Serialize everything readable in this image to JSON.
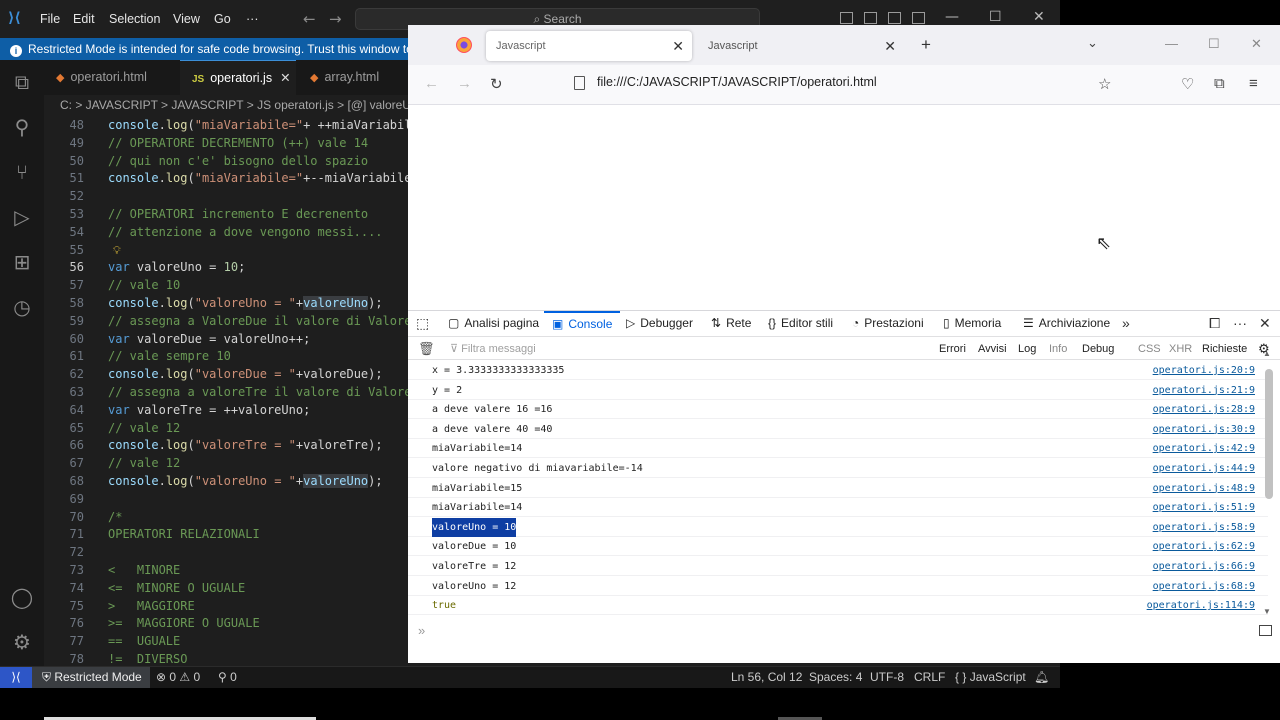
{
  "vscode": {
    "menu": [
      "File",
      "Edit",
      "Selection",
      "View",
      "Go",
      "···"
    ],
    "search_label": "Search",
    "banner": "Restricted Mode is intended for safe code browsing. Trust this window to enable all features.",
    "tabs": [
      {
        "label": "operatori.html",
        "active": false
      },
      {
        "label": "operatori.js",
        "active": true
      },
      {
        "label": "array.html",
        "active": false
      }
    ],
    "breadcrumb": "C: > JAVASCRIPT > JAVASCRIPT > JS operatori.js > [@] valoreUno",
    "lines": [
      {
        "n": "48",
        "t": "console.log(\"miaVariabile=\"+ ++miaVariabile);"
      },
      {
        "n": "49",
        "t": "// OPERATORE DECREMENTO (++) vale 14"
      },
      {
        "n": "50",
        "t": "// qui non c'e' bisogno dello spazio"
      },
      {
        "n": "51",
        "t": "console.log(\"miaVariabile=\"+--miaVariabile);"
      },
      {
        "n": "52",
        "t": ""
      },
      {
        "n": "53",
        "t": "// OPERATORI incremento E decrenento"
      },
      {
        "n": "54",
        "t": "// attenzione a dove vengono messi...."
      },
      {
        "n": "55",
        "t": ""
      },
      {
        "n": "56",
        "t": "var valoreUno = 10;"
      },
      {
        "n": "57",
        "t": "// vale 10"
      },
      {
        "n": "58",
        "t": "console.log(\"valoreUno = \"+valoreUno);"
      },
      {
        "n": "59",
        "t": "// assegna a ValoreDue il valore di ValoreUno"
      },
      {
        "n": "60",
        "t": "var valoreDue = valoreUno++;"
      },
      {
        "n": "61",
        "t": "// vale sempre 10"
      },
      {
        "n": "62",
        "t": "console.log(\"valoreDue = \"+valoreDue);"
      },
      {
        "n": "63",
        "t": "// assegna a valoreTre il valore di ValoreUno"
      },
      {
        "n": "64",
        "t": "var valoreTre = ++valoreUno;"
      },
      {
        "n": "65",
        "t": "// vale 12"
      },
      {
        "n": "66",
        "t": "console.log(\"valoreTre = \"+valoreTre);"
      },
      {
        "n": "67",
        "t": "// vale 12"
      },
      {
        "n": "68",
        "t": "console.log(\"valoreUno = \"+valoreUno);"
      },
      {
        "n": "69",
        "t": ""
      },
      {
        "n": "70",
        "t": "/*"
      },
      {
        "n": "71",
        "t": "OPERATORI RELAZIONALI"
      },
      {
        "n": "72",
        "t": ""
      },
      {
        "n": "73",
        "t": "<   MINORE"
      },
      {
        "n": "74",
        "t": "<=  MINORE O UGUALE"
      },
      {
        "n": "75",
        "t": ">   MAGGIORE"
      },
      {
        "n": "76",
        "t": ">=  MAGGIORE O UGUALE"
      },
      {
        "n": "77",
        "t": "==  UGUALE"
      },
      {
        "n": "78",
        "t": "!=  DIVERSO"
      }
    ],
    "status": {
      "restricted": "Restricted Mode",
      "problems": "0 ⚠ 0",
      "ports": "0",
      "position": "Ln 56, Col 12",
      "spaces": "Spaces: 4",
      "encoding": "UTF-8",
      "eol": "CRLF",
      "language": "JavaScript"
    }
  },
  "firefox": {
    "tabs": [
      {
        "label": "Javascript",
        "active": true
      },
      {
        "label": "Javascript",
        "active": false
      }
    ],
    "url": "file:///C:/JAVASCRIPT/JAVASCRIPT/operatori.html",
    "devtools_tabs": [
      "Analisi pagina",
      "Console",
      "Debugger",
      "Rete",
      "Editor stili",
      "Prestazioni",
      "Memoria",
      "Archiviazione"
    ],
    "filter_placeholder": "Filtra messaggi",
    "filters": [
      "Errori",
      "Avvisi",
      "Log",
      "Info",
      "Debug",
      "CSS",
      "XHR",
      "Richieste"
    ],
    "console": [
      {
        "msg": "x = 3.3333333333333335",
        "src": "operatori.js:20:9"
      },
      {
        "msg": "y = 2",
        "src": "operatori.js:21:9"
      },
      {
        "msg": "a deve valere 16 =16",
        "src": "operatori.js:28:9"
      },
      {
        "msg": "a deve valere 40 =40",
        "src": "operatori.js:30:9"
      },
      {
        "msg": "miaVariabile=14",
        "src": "operatori.js:42:9"
      },
      {
        "msg": "valore negativo di miavariabile=-14",
        "src": "operatori.js:44:9"
      },
      {
        "msg": "miaVariabile=15",
        "src": "operatori.js:48:9"
      },
      {
        "msg": "miaVariabile=14",
        "src": "operatori.js:51:9"
      },
      {
        "msg": "valoreUno = 10",
        "src": "operatori.js:58:9",
        "selected": true
      },
      {
        "msg": "valoreDue = 10",
        "src": "operatori.js:62:9"
      },
      {
        "msg": "valoreTre = 12",
        "src": "operatori.js:66:9"
      },
      {
        "msg": "valoreUno = 12",
        "src": "operatori.js:68:9"
      },
      {
        "msg": "true",
        "src": "operatori.js:114:9",
        "bool": true
      }
    ]
  }
}
